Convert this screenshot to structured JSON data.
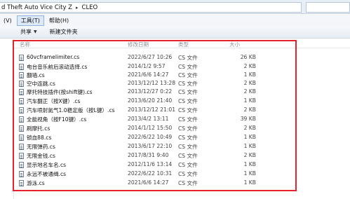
{
  "address": {
    "crumbs": [
      "d Theft Auto Vice City Z",
      "CLEO"
    ],
    "separator": "▸"
  },
  "menu": {
    "items": [
      {
        "label": "(V)"
      },
      {
        "label": "工具(T)",
        "active": true
      },
      {
        "label": "帮助(H)"
      }
    ]
  },
  "toolbar": {
    "share_label": "共享",
    "new_folder_label": "新建文件夹"
  },
  "columns": {
    "name": "名称",
    "date": "修改日期",
    "type": "类型",
    "size": "大小"
  },
  "files": [
    {
      "name": "60vcframelimiter.cs",
      "date": "2022/6/27 10:26",
      "type": "CS 文件",
      "size": "26 KB"
    },
    {
      "name": "电台音乐前后滚动选择.cs",
      "date": "2014/1/2 9:57",
      "type": "CS 文件",
      "size": "2 KB"
    },
    {
      "name": "翻墙.cs",
      "date": "2021/6/6 14:27",
      "type": "CS 文件",
      "size": "1 KB"
    },
    {
      "name": "空中连跳.cs",
      "date": "2013/12/12 13:28",
      "type": "CS 文件",
      "size": "2 KB"
    },
    {
      "name": "摩托特技插件(按shift键).cs",
      "date": "2013/12/27 0:22",
      "type": "CS 文件",
      "size": "2 KB"
    },
    {
      "name": "汽车翻正（按X键）.cs",
      "date": "2013/6/20 21:40",
      "type": "CS 文件",
      "size": "1 KB"
    },
    {
      "name": "汽车喷射氮气1.0稳定版（按L键）.cs",
      "date": "2013/12/12 21:01",
      "type": "CS 文件",
      "size": "2 KB"
    },
    {
      "name": "全能视角（按F10键）.cs",
      "date": "2013/4/2 13:11",
      "type": "CS 文件",
      "size": "39 KB"
    },
    {
      "name": "刷摩托.cs",
      "date": "2014/1/12 15:50",
      "type": "CS 文件",
      "size": "2 KB"
    },
    {
      "name": "锁血88.cs",
      "date": "2022/6/22 10:49",
      "type": "CS 文件",
      "size": "1 KB"
    },
    {
      "name": "无限弹药.cs",
      "date": "2013/6/17 22:10",
      "type": "CS 文件",
      "size": "1 KB"
    },
    {
      "name": "无限金钱.cs",
      "date": "2017/8/31 9:40",
      "type": "CS 文件",
      "size": "2 KB"
    },
    {
      "name": "显示地名车名.cs",
      "date": "2012/11/6 13:14",
      "type": "CS 文件",
      "size": "1 KB"
    },
    {
      "name": "永远不被通缉.cs",
      "date": "2022/6/22 10:31",
      "type": "CS 文件",
      "size": "1 KB"
    },
    {
      "name": "游泳.cs",
      "date": "2021/6/6 14:27",
      "type": "CS 文件",
      "size": "1 KB"
    }
  ],
  "colors": {
    "highlight": "#e8222b",
    "header_text": "#8a8f97",
    "file_icon_border": "#6b7c93"
  }
}
